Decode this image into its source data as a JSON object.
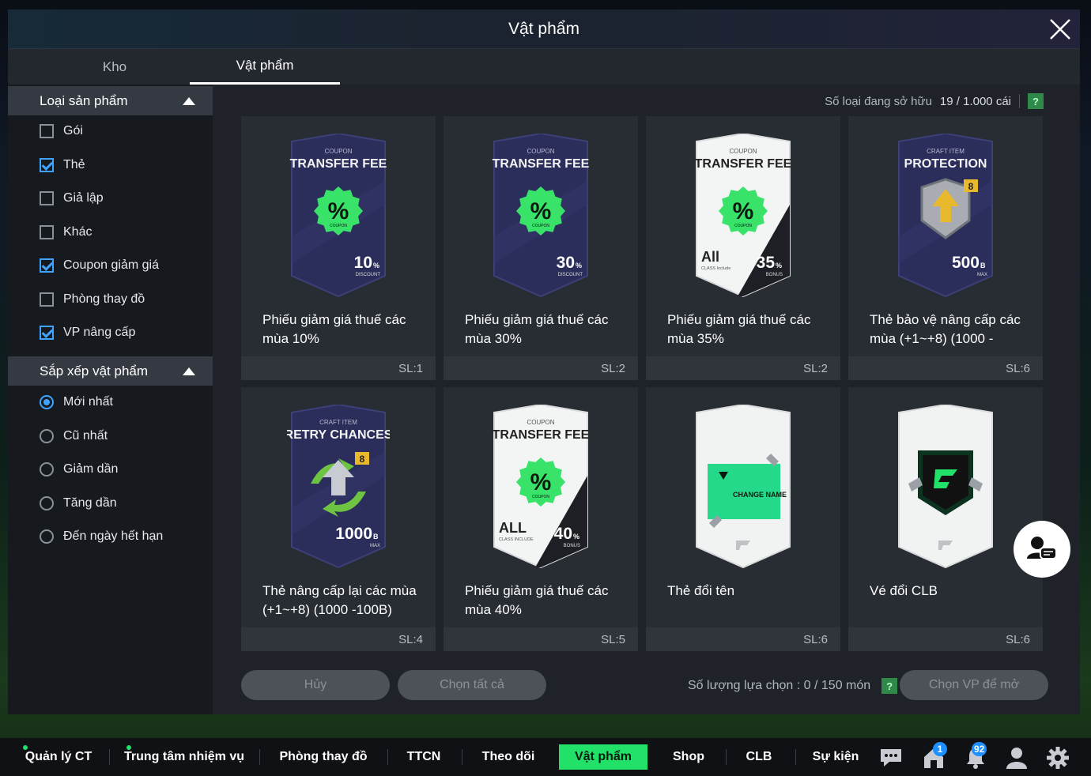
{
  "title": "Vật phẩm",
  "tabs": [
    {
      "label": "Kho"
    },
    {
      "label": "Vật phẩm"
    }
  ],
  "sidebar": {
    "type_header": "Loại sản phẩm",
    "types": [
      {
        "label": "Gói",
        "checked": false
      },
      {
        "label": "Thẻ",
        "checked": true
      },
      {
        "label": "Giả lập",
        "checked": false
      },
      {
        "label": "Khác",
        "checked": false
      },
      {
        "label": "Coupon giảm giá",
        "checked": true
      },
      {
        "label": "Phòng thay đồ",
        "checked": false
      },
      {
        "label": "VP nâng cấp",
        "checked": true
      }
    ],
    "sort_header": "Sắp xếp vật phẩm",
    "sorts": [
      {
        "label": "Mới nhất",
        "selected": true
      },
      {
        "label": "Cũ nhất",
        "selected": false
      },
      {
        "label": "Giảm dần",
        "selected": false
      },
      {
        "label": "Tăng dần",
        "selected": false
      },
      {
        "label": "Đến ngày hết hạn",
        "selected": false
      }
    ]
  },
  "owned": {
    "label": "Số loại đang sở hữu",
    "value": "19 / 1.000 cái",
    "help": "?"
  },
  "items": [
    {
      "name": "Phiếu giảm giá thuế các mùa 10%",
      "qty": "SL:1",
      "card": {
        "style": "dark",
        "kicker": "COUPON",
        "heading": "TRANSFER FEE",
        "badge": "%",
        "badge_sub": "COUPON",
        "big": "10",
        "unit": "%",
        "sub": "DISCOUNT"
      }
    },
    {
      "name": "Phiếu giảm giá thuế các mùa 30%",
      "qty": "SL:2",
      "card": {
        "style": "dark",
        "kicker": "COUPON",
        "heading": "TRANSFER FEE",
        "badge": "%",
        "badge_sub": "COUPON",
        "big": "30",
        "unit": "%",
        "sub": "DISCOUNT"
      }
    },
    {
      "name": "Phiếu giảm giá thuế các mùa 35%",
      "qty": "SL:2",
      "card": {
        "style": "light",
        "kicker": "COUPON",
        "heading": "TRANSFER FEE",
        "badge": "%",
        "badge_sub": "COUPON",
        "big": "35",
        "unit": "%",
        "sub": "BONUS",
        "corner": "All",
        "corner_sub": "CLASS Include"
      }
    },
    {
      "name": "Thẻ bảo vệ nâng cấp các mùa (+1~+8) (1000 -",
      "qty": "SL:6",
      "card": {
        "style": "dark",
        "kicker": "CRAFT ITEM",
        "heading": "PROTECTION",
        "big": "500",
        "unit": "B",
        "sub": "MAX",
        "level": "8"
      }
    },
    {
      "name": "Thẻ nâng cấp lại các mùa (+1~+8) (1000 -100B)",
      "qty": "SL:4",
      "card": {
        "style": "dark",
        "kicker": "CRAFT ITEM",
        "heading": "RETRY CHANCES",
        "big": "1000",
        "unit": "B",
        "sub": "MAX",
        "level": "8"
      }
    },
    {
      "name": "Phiếu giảm giá thuế các mùa 40%",
      "qty": "SL:5",
      "card": {
        "style": "light",
        "kicker": "COUPON",
        "heading": "TRANSFER FEE",
        "badge": "%",
        "badge_sub": "COUPON",
        "big": "40",
        "unit": "%",
        "sub": "BONUS",
        "corner": "ALL",
        "corner_sub": "CLASS INCLUDE"
      }
    },
    {
      "name": "Thẻ đổi tên",
      "qty": "SL:6",
      "card": {
        "style": "white",
        "ticket": "CHANGE NAME"
      }
    },
    {
      "name": "Vé đổi CLB",
      "qty": "SL:6",
      "card": {
        "style": "white"
      }
    }
  ],
  "actions": {
    "cancel": "Hủy",
    "select_all": "Chọn tất cả",
    "selected_label": "Số lượng lựa chọn : 0 / 150 món",
    "help": "?",
    "open": "Chọn VP để mở"
  },
  "bottom_nav": [
    {
      "label": "Quản lý CT",
      "dot": true
    },
    {
      "label": "Trung tâm nhiệm vụ",
      "dot": true
    },
    {
      "label": "Phòng thay đồ"
    },
    {
      "label": "TTCN"
    },
    {
      "label": "Theo dõi"
    },
    {
      "label": "Vật phẩm",
      "active": true
    },
    {
      "label": "Shop"
    },
    {
      "label": "CLB"
    },
    {
      "label": "Sự kiện"
    }
  ],
  "badges": {
    "home": "1",
    "bell": "92"
  },
  "colors": {
    "accent": "#21e169",
    "check": "#3ea4ff",
    "card_dark": "#2b2d5a",
    "coupon_green": "#39e36a"
  }
}
